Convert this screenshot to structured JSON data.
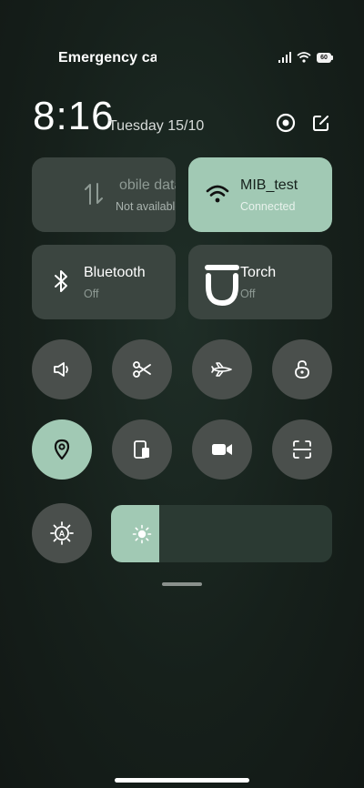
{
  "status_bar": {
    "carrier": "Emergency calls only",
    "battery": "60"
  },
  "header": {
    "time": "8:16",
    "date": "Tuesday 15/10"
  },
  "tiles": {
    "mobile_data": {
      "title": "Mobile data",
      "shown_title": "obile data",
      "status": "Not available",
      "active": false
    },
    "wifi": {
      "title": "MIB_test",
      "status": "Connected",
      "active": true
    },
    "bluetooth": {
      "title": "Bluetooth",
      "status": "Off",
      "active": false
    },
    "torch": {
      "title": "Torch",
      "status": "Off",
      "active": false
    }
  },
  "toggles": [
    {
      "icon": "speaker-icon",
      "active": false
    },
    {
      "icon": "scissors-icon",
      "active": false
    },
    {
      "icon": "airplane-icon",
      "active": false
    },
    {
      "icon": "rotation-lock-icon",
      "active": false
    },
    {
      "icon": "location-icon",
      "active": true
    },
    {
      "icon": "device-icon",
      "active": false
    },
    {
      "icon": "video-camera-icon",
      "active": false
    },
    {
      "icon": "scan-icon",
      "active": false
    }
  ],
  "brightness": {
    "level": 0.22,
    "auto": true
  },
  "colors": {
    "accent": "#a1c9b4",
    "tile": "#3b4540",
    "round_button": "#4a4f4c"
  }
}
